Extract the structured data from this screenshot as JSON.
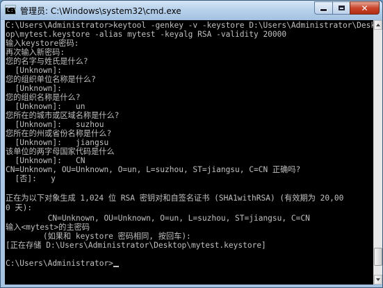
{
  "window": {
    "title": "管理员: C:\\Windows\\system32\\cmd.exe",
    "icon": "console-icon",
    "icon_glyph": "C:\\",
    "minimize_icon": "minimize-icon",
    "maximize_icon": "maximize-icon",
    "close_icon": "close-icon",
    "close_glyph": "✕"
  },
  "console": {
    "lines": [
      "C:\\Users\\Administrator>keytool -genkey -v -keystore D:\\Users\\Administrator\\Deskt",
      "op\\mytest.keystore -alias mytest -keyalg RSA -validity 20000",
      "输入keystore密码:",
      "再次输入新密码:",
      "您的名字与姓氏是什么?",
      "  [Unknown]:",
      "您的组织单位名称是什么?",
      "  [Unknown]:",
      "您的组织名称是什么?",
      "  [Unknown]:   un",
      "您所在的城市或区域名称是什么?",
      "  [Unknown]:   suzhou",
      "您所在的州或省份名称是什么?",
      "  [Unknown]:   jiangsu",
      "该单位的两字母国家代码是什么",
      "  [Unknown]:   CN",
      "CN=Unknown, OU=Unknown, O=un, L=suzhou, ST=jiangsu, C=CN 正确吗?",
      "  [否]:   y",
      "",
      "正在为以下对象生成 1,024 位 RSA 密钥对和自签名证书 (SHA1withRSA) (有效期为 20,00",
      "0 天):",
      "         CN=Unknown, OU=Unknown, O=un, L=suzhou, ST=jiangsu, C=CN",
      "输入<mytest>的主密码",
      "        (如果和 keystore 密码相同, 按回车):",
      "[正在存储 D:\\Users\\Administrator\\Desktop\\mytest.keystore]",
      "",
      "C:\\Users\\Administrator>"
    ]
  },
  "scrollbar": {
    "position": 0.96
  }
}
